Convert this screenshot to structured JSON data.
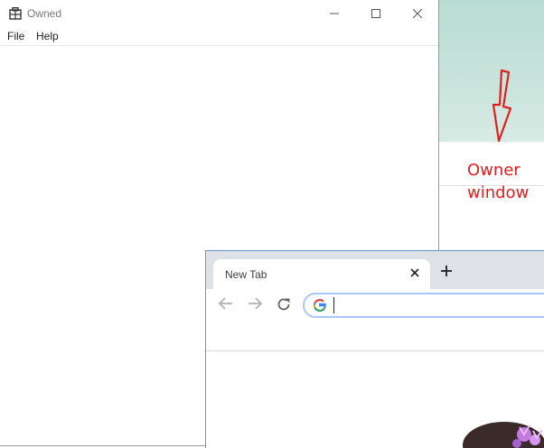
{
  "owned_window": {
    "title": "Owned",
    "menu": {
      "file": "File",
      "help": "Help"
    }
  },
  "owner_window": {
    "label_line1": "Owner",
    "label_line2": "window",
    "label_color": "#e02020"
  },
  "browser": {
    "tab_title": "New Tab",
    "omnibox_value": "",
    "accent_color": "#a8c7fa"
  },
  "icons": {
    "owned_app": "app-icon",
    "minimize": "minimize-icon",
    "maximize": "maximize-icon",
    "close": "close-icon",
    "tab_close": "close-icon",
    "new_tab": "plus-icon",
    "back": "arrow-left-icon",
    "forward": "arrow-right-icon",
    "reload": "reload-icon",
    "search_provider": "google-g-icon",
    "annotation_arrow": "arrow-down-icon"
  }
}
